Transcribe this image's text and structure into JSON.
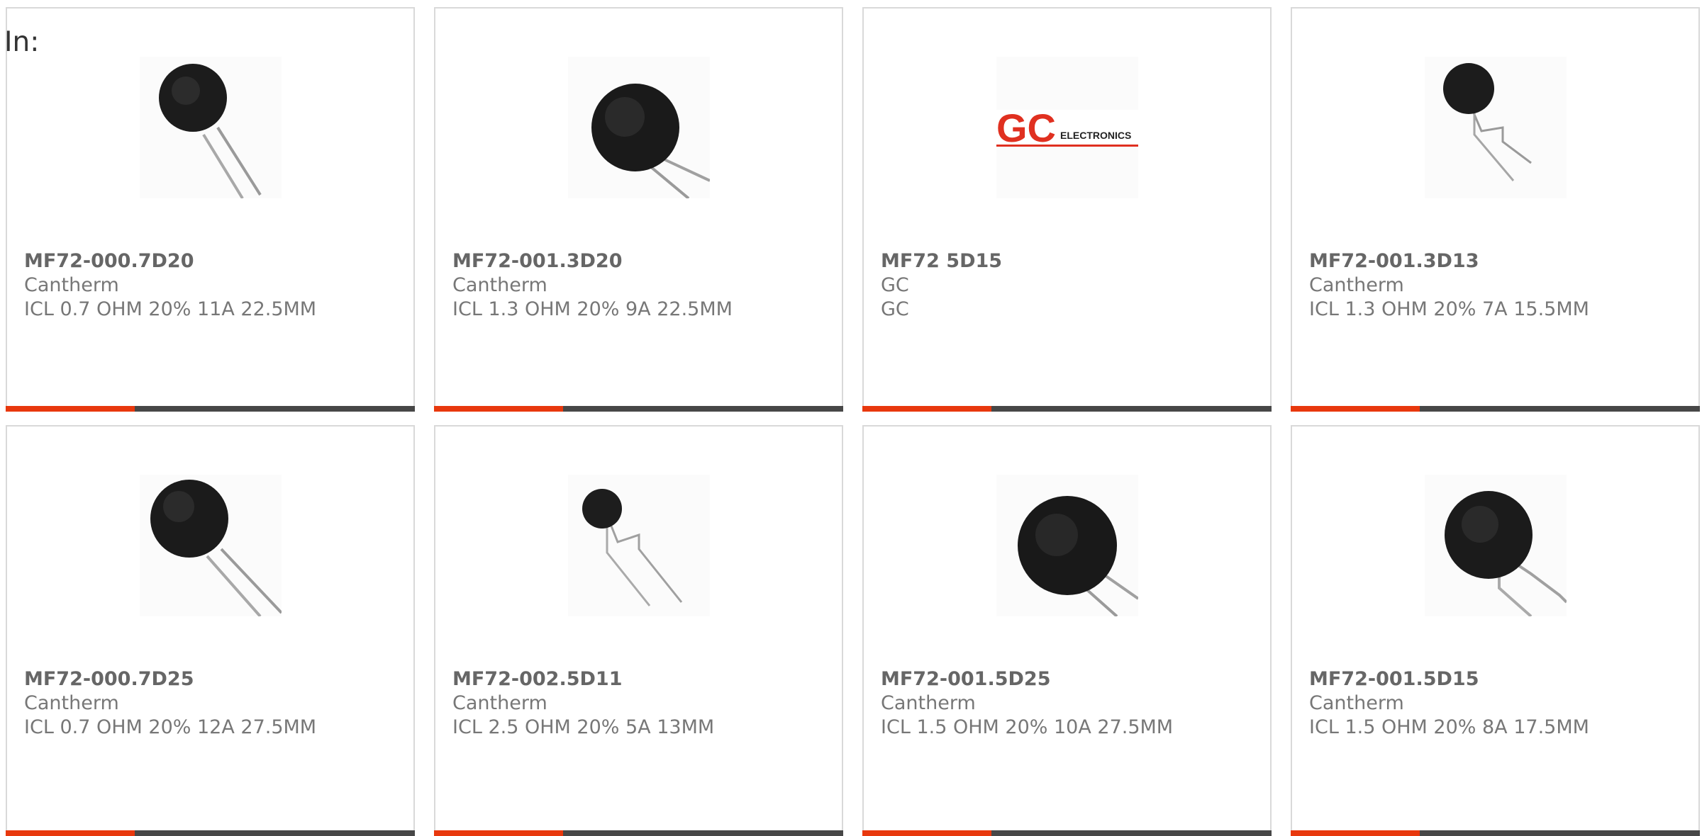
{
  "page": {
    "in_label": "In:"
  },
  "colors": {
    "accent": "#e8380d",
    "bar": "#474747",
    "border": "#d9d9d9",
    "text": "#777777"
  },
  "products": [
    {
      "part_number": "MF72-000.7D20",
      "manufacturer": "Cantherm",
      "description": "ICL 0.7 OHM 20% 11A 22.5MM",
      "image": "thermistor-disc-icon"
    },
    {
      "part_number": "MF72-001.3D20",
      "manufacturer": "Cantherm",
      "description": "ICL 1.3 OHM 20% 9A 22.5MM",
      "image": "thermistor-disc-icon"
    },
    {
      "part_number": "MF72 5D15",
      "manufacturer": "GC",
      "description": "GC",
      "image": "gc-electronics-logo",
      "logo_text": "GC",
      "logo_subtext": "ELECTRONICS"
    },
    {
      "part_number": "MF72-001.3D13",
      "manufacturer": "Cantherm",
      "description": "ICL 1.3 OHM 20% 7A 15.5MM",
      "image": "thermistor-disc-icon"
    },
    {
      "part_number": "MF72-000.7D25",
      "manufacturer": "Cantherm",
      "description": "ICL 0.7 OHM 20% 12A 27.5MM",
      "image": "thermistor-disc-icon"
    },
    {
      "part_number": "MF72-002.5D11",
      "manufacturer": "Cantherm",
      "description": "ICL 2.5 OHM 20% 5A 13MM",
      "image": "thermistor-disc-icon"
    },
    {
      "part_number": "MF72-001.5D25",
      "manufacturer": "Cantherm",
      "description": "ICL 1.5 OHM 20% 10A 27.5MM",
      "image": "thermistor-disc-icon"
    },
    {
      "part_number": "MF72-001.5D15",
      "manufacturer": "Cantherm",
      "description": "ICL 1.5 OHM 20% 8A 17.5MM",
      "image": "thermistor-disc-icon"
    }
  ]
}
